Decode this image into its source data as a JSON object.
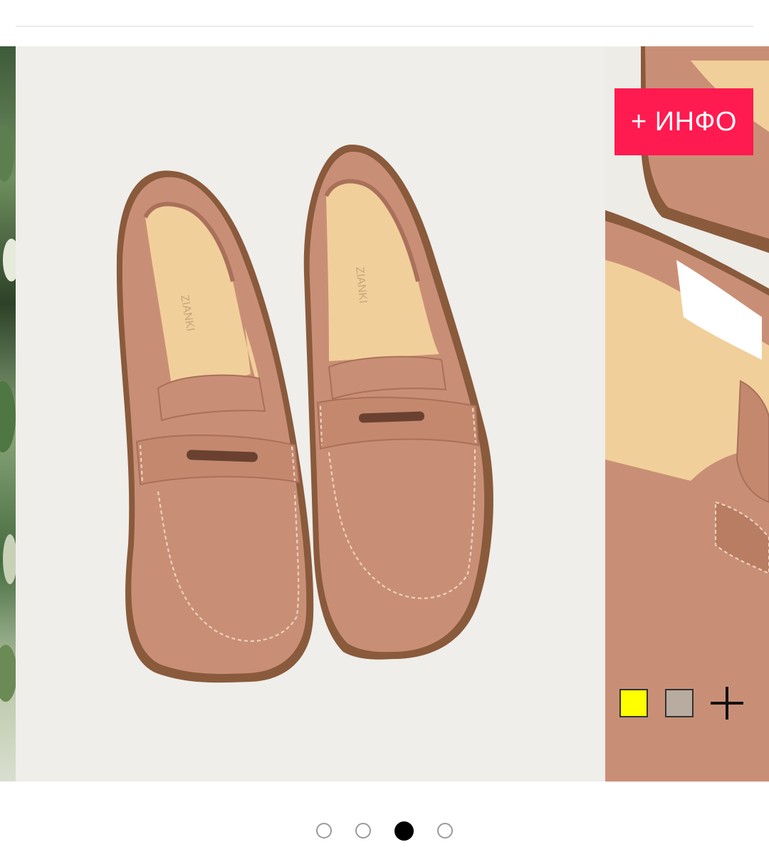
{
  "gallery": {
    "info_button_label": "+ ИНФО",
    "main_image_alt": "Suede penny loafers",
    "insole_brand_text": "ZIANKI",
    "colors": {
      "suede": "#c98f76",
      "suede_shadow": "#a9705a",
      "insole": "#f1cf9a",
      "sole": "#8a5a3c",
      "background": "#efeeea"
    },
    "swatches": [
      {
        "name": "yellow",
        "color": "#ffff00"
      },
      {
        "name": "taupe",
        "color": "#b8aba0"
      }
    ],
    "more_colors_icon": "plus-icon",
    "pager": {
      "total": 4,
      "active_index": 2
    }
  }
}
